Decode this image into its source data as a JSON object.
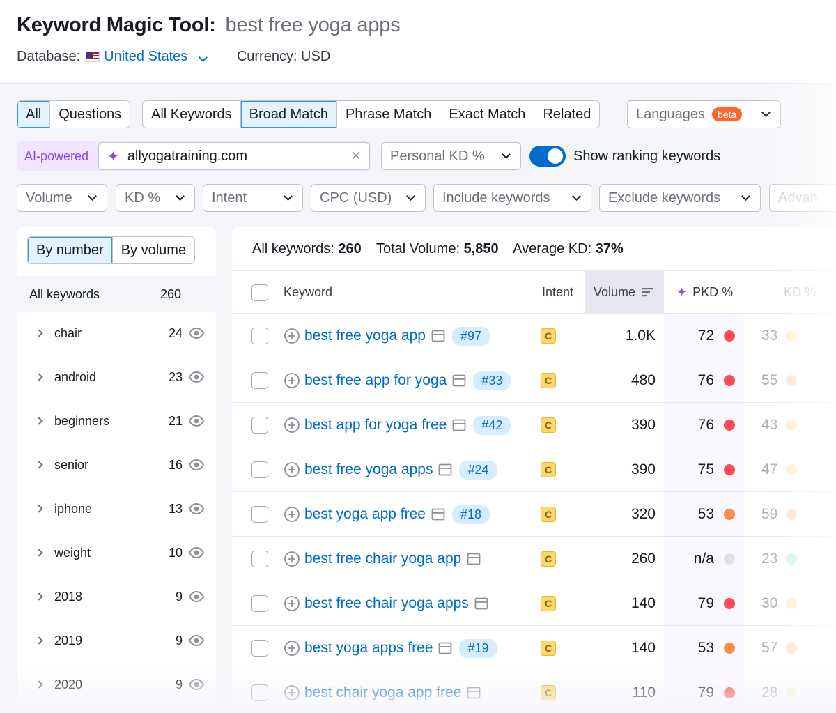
{
  "header": {
    "title": "Keyword Magic Tool:",
    "query": "best free yoga apps",
    "database_label": "Database:",
    "database_value": "United States",
    "currency": "Currency: USD"
  },
  "filters": {
    "type_tabs": [
      "All",
      "Questions"
    ],
    "match_tabs": [
      "All Keywords",
      "Broad Match",
      "Phrase Match",
      "Exact Match",
      "Related"
    ],
    "languages": "Languages",
    "beta": "beta",
    "ai_label": "AI-powered",
    "domain_value": "allyogatraining.com",
    "personal_kd": "Personal KD %",
    "show_ranking": "Show ranking keywords",
    "dropdowns": [
      "Volume",
      "KD %",
      "Intent",
      "CPC (USD)",
      "Include keywords",
      "Exclude keywords",
      "Advan"
    ]
  },
  "sidebar": {
    "tabs": [
      "By number",
      "By volume"
    ],
    "all_keywords_label": "All keywords",
    "all_keywords_count": "260",
    "groups": [
      {
        "name": "chair",
        "count": "24"
      },
      {
        "name": "android",
        "count": "23"
      },
      {
        "name": "beginners",
        "count": "21"
      },
      {
        "name": "senior",
        "count": "16"
      },
      {
        "name": "iphone",
        "count": "13"
      },
      {
        "name": "weight",
        "count": "10"
      },
      {
        "name": "2018",
        "count": "9"
      },
      {
        "name": "2019",
        "count": "9"
      },
      {
        "name": "2020",
        "count": "9"
      }
    ]
  },
  "summary": {
    "all_keywords_label": "All keywords:",
    "all_keywords_value": "260",
    "total_volume_label": "Total Volume:",
    "total_volume_value": "5,850",
    "avg_kd_label": "Average KD:",
    "avg_kd_value": "37%"
  },
  "table": {
    "columns": {
      "keyword": "Keyword",
      "intent": "Intent",
      "volume": "Volume",
      "pkd": "PKD %",
      "kd": "KD %"
    },
    "rows": [
      {
        "keyword": "best free yoga app",
        "rank": "#97",
        "intent": "C",
        "volume": "1.0K",
        "pkd": "72",
        "pkd_color": "#ff4953",
        "kd": "33",
        "kd_color": "#f5c86b"
      },
      {
        "keyword": "best free app for yoga",
        "rank": "#33",
        "intent": "C",
        "volume": "480",
        "pkd": "76",
        "pkd_color": "#ff4953",
        "kd": "55",
        "kd_color": "#f5a06b"
      },
      {
        "keyword": "best app for yoga free",
        "rank": "#42",
        "intent": "C",
        "volume": "390",
        "pkd": "76",
        "pkd_color": "#ff4953",
        "kd": "43",
        "kd_color": "#f5c86b"
      },
      {
        "keyword": "best free yoga apps",
        "rank": "#24",
        "intent": "C",
        "volume": "390",
        "pkd": "75",
        "pkd_color": "#ff4953",
        "kd": "47",
        "kd_color": "#f5c86b"
      },
      {
        "keyword": "best yoga app free",
        "rank": "#18",
        "intent": "C",
        "volume": "320",
        "pkd": "53",
        "pkd_color": "#ff8c43",
        "kd": "59",
        "kd_color": "#f5a06b"
      },
      {
        "keyword": "best free chair yoga app",
        "rank": "",
        "intent": "C",
        "volume": "260",
        "pkd": "n/a",
        "pkd_color": "#dfe1ea",
        "kd": "23",
        "kd_color": "#6fd6a8"
      },
      {
        "keyword": "best free chair yoga apps",
        "rank": "",
        "intent": "C",
        "volume": "140",
        "pkd": "79",
        "pkd_color": "#ff4953",
        "kd": "30",
        "kd_color": "#f5c86b"
      },
      {
        "keyword": "best yoga apps free",
        "rank": "#19",
        "intent": "C",
        "volume": "140",
        "pkd": "53",
        "pkd_color": "#ff8c43",
        "kd": "57",
        "kd_color": "#f5a06b"
      },
      {
        "keyword": "best chair yoga app free",
        "rank": "",
        "intent": "C",
        "volume": "110",
        "pkd": "79",
        "pkd_color": "#ff4953",
        "kd": "28",
        "kd_color": "#f5c86b"
      }
    ]
  }
}
